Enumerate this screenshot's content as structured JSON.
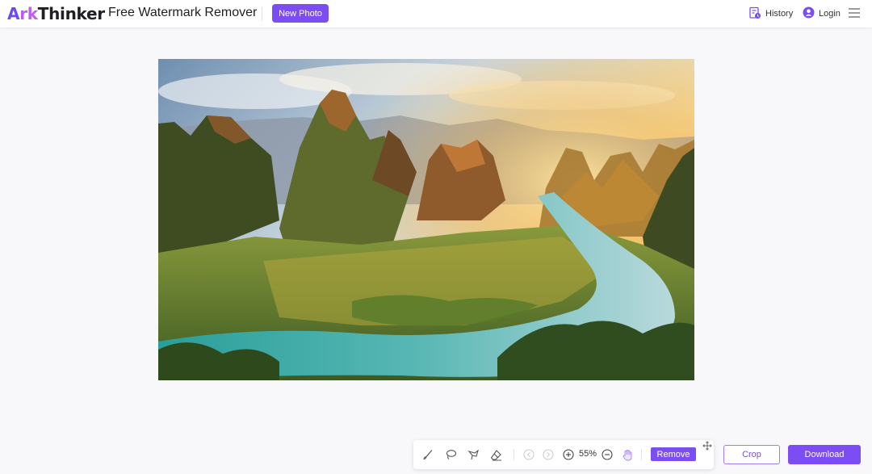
{
  "header": {
    "logo": {
      "part_a": "A",
      "part_rk": "rk",
      "part_rest": "Thinker"
    },
    "app_title": "Free Watermark Remover",
    "new_photo_label": "New Photo",
    "history_label": "History",
    "login_label": "Login",
    "icons": {
      "history": "history-icon",
      "login": "user-icon",
      "menu": "hamburger-menu-icon"
    }
  },
  "editor": {
    "image_description": "photo-being-edited",
    "toolbar": {
      "tools": [
        "brush-icon",
        "lasso-icon",
        "polygon-lasso-icon",
        "eraser-icon",
        "undo-icon",
        "redo-icon",
        "zoom-in-icon",
        "zoom-out-icon",
        "hand-icon"
      ],
      "zoom_level": "55%",
      "remove_label": "Remove"
    },
    "crop_label": "Crop",
    "download_label": "Download"
  },
  "colors": {
    "accent": "#7b4df2",
    "background": "#f8f8fa",
    "logo_a": "#6c4bf5",
    "logo_rk": "#c05cf0"
  }
}
